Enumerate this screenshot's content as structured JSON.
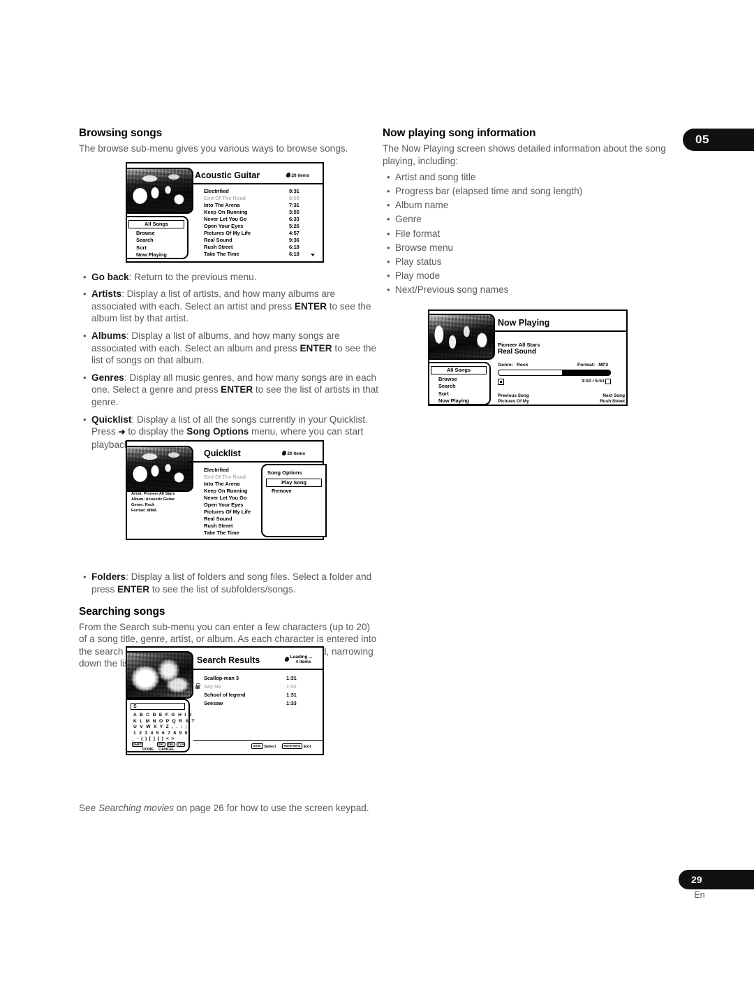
{
  "chapter_tab": "05",
  "footer": {
    "page_number": "29",
    "language": "En"
  },
  "left_column": {
    "section1": {
      "heading": "Browsing songs",
      "intro": "The browse sub-menu gives you various ways to browse songs.",
      "bullets": [
        {
          "term": "Go back",
          "text": ": Return to the previous menu."
        },
        {
          "term": "Artists",
          "text": ": Display a list of artists, and how many albums are associated with each. Select an artist and press ",
          "bold2": "ENTER",
          "text2": " to see the album list by that artist."
        },
        {
          "term": "Albums",
          "text": ": Display a list of albums, and how many songs are associated with each. Select an album and press ",
          "bold2": "ENTER",
          "text2": " to see the list of songs on that album."
        },
        {
          "term": "Genres",
          "text": ": Display all music genres, and how many songs are in each one. Select a genre and press ",
          "bold2": "ENTER",
          "text2": " to see the list of artists in that genre."
        },
        {
          "term": "Quicklist",
          "text": ": Display a list of all the songs currently in your Quicklist. Press ",
          "arrow": "➜",
          "text2": " to display the ",
          "bold2": "Song Options",
          "text3": " menu, where you can start playback or remove songs from the Quicklist:"
        },
        {
          "term": "Folders",
          "text": ": Display a list of folders and song files. Select a folder and press ",
          "bold2": "ENTER",
          "text2": " to see the list of subfolders/songs."
        }
      ]
    },
    "section2": {
      "heading": "Searching songs",
      "intro": "From the Search sub-menu you can enter a few characters (up to 20) of a song title, genre, artist, or album. As each character is entered into the search field the search results are dynamically updated, narrowing down the list until you can see the one you're looking for.",
      "caption_pre": "See ",
      "caption_italic": "Searching movies",
      "caption_post": " on page 26 for how to use the screen keypad."
    }
  },
  "right_column": {
    "heading": "Now playing song information",
    "intro": "The Now Playing screen shows detailed information about the song playing, including:",
    "bullets": [
      "Artist and song title",
      "Progress bar (elapsed time and song length)",
      "Album name",
      "Genre",
      "File format",
      "Browse menu",
      "Play status",
      "Play mode",
      "Next/Previous song names"
    ]
  },
  "screens": {
    "browse": {
      "title": "Acoustic Guitar",
      "items_count": "20 items",
      "nav": [
        "All Songs",
        "Browse",
        "Search",
        "Sort",
        "Now Playing"
      ],
      "nav_selected": "All Songs",
      "songs": [
        {
          "name": "Electrified",
          "time": "9:31",
          "dim": false
        },
        {
          "name": "End Of The Road",
          "time": "8:00",
          "dim": true
        },
        {
          "name": "Into The Arena",
          "time": "7:31",
          "dim": false
        },
        {
          "name": "Keep On Running",
          "time": "3:55",
          "dim": false
        },
        {
          "name": "Never Let You Go",
          "time": "6:33",
          "dim": false
        },
        {
          "name": "Open Your Eyes",
          "time": "5:26",
          "dim": false
        },
        {
          "name": "Pictures Of My Life",
          "time": "4:57",
          "dim": false
        },
        {
          "name": "Real Sound",
          "time": "9:36",
          "dim": false
        },
        {
          "name": "Rush Street",
          "time": "6:18",
          "dim": false
        },
        {
          "name": "Take The Time",
          "time": "6:18",
          "dim": false
        }
      ]
    },
    "quicklist": {
      "title": "Quicklist",
      "items_count": "20 items",
      "meta": [
        "Artist: Pioneer All Stars",
        "Album: Acoustic Guitar",
        "Genre: Rock",
        "Format: WMA"
      ],
      "songs": [
        {
          "name": "Electrified",
          "dim": false
        },
        {
          "name": "End Of The Road",
          "dim": true
        },
        {
          "name": "Into The Arena",
          "dim": false
        },
        {
          "name": "Keep On Running",
          "dim": false
        },
        {
          "name": "Never Let You Go",
          "dim": false
        },
        {
          "name": "Open Your Eyes",
          "dim": false
        },
        {
          "name": "Pictures Of My Life",
          "dim": false
        },
        {
          "name": "Real Sound",
          "dim": false
        },
        {
          "name": "Rush Street",
          "dim": false
        },
        {
          "name": "Take The Time",
          "dim": false
        }
      ],
      "options_title": "Song Options",
      "options": [
        "Play Song",
        "Remove"
      ],
      "options_selected": "Play Song"
    },
    "search": {
      "title": "Search Results",
      "status": "Loading ...",
      "items_count": "4 items",
      "results": [
        {
          "name": "Scallop-man 3",
          "time": "1:31",
          "dim": false,
          "locked": false
        },
        {
          "name": "Say No",
          "time": "1:02",
          "dim": true,
          "locked": true
        },
        {
          "name": "School of legend",
          "time": "1:31",
          "dim": false,
          "locked": false
        },
        {
          "name": "Seesaw",
          "time": "1:33",
          "dim": false,
          "locked": false
        }
      ],
      "keypad": {
        "field_value": "S_",
        "rows": [
          "A B C D E F G H I J",
          "K L M N O P Q R S T",
          "U V W X Y Z , . : ;",
          "1 2 3 4 5 6 7 8 9 0"
        ],
        "symbol_row": "_ - ( ) [ ] { } < >",
        "keys": [
          "SHIFT",
          "SPC",
          "DEL",
          "CLR"
        ],
        "done": "DONE",
        "cancel": "CANCEL"
      },
      "footbar": {
        "select_key": "Enter",
        "select_label": "Select",
        "exit_key": "Home Menu",
        "exit_label": "Exit"
      }
    },
    "now_playing": {
      "title": "Now Playing",
      "artist": "Pioneer All Stars",
      "song": "Real Sound",
      "genre_label": "Genre:",
      "genre_value": "Rock",
      "format_label": "Format:",
      "format_value": "MP3",
      "elapsed_total": "3:10 / 5:51",
      "progress_percent": 57,
      "nav": [
        "All Songs",
        "Browse",
        "Search",
        "Sort",
        "Now Playing"
      ],
      "nav_selected": "All Songs",
      "prev_label": "Previous Song",
      "prev_song": "Pictures Of My",
      "next_label": "Next Song",
      "next_song": "Rush Street"
    }
  }
}
